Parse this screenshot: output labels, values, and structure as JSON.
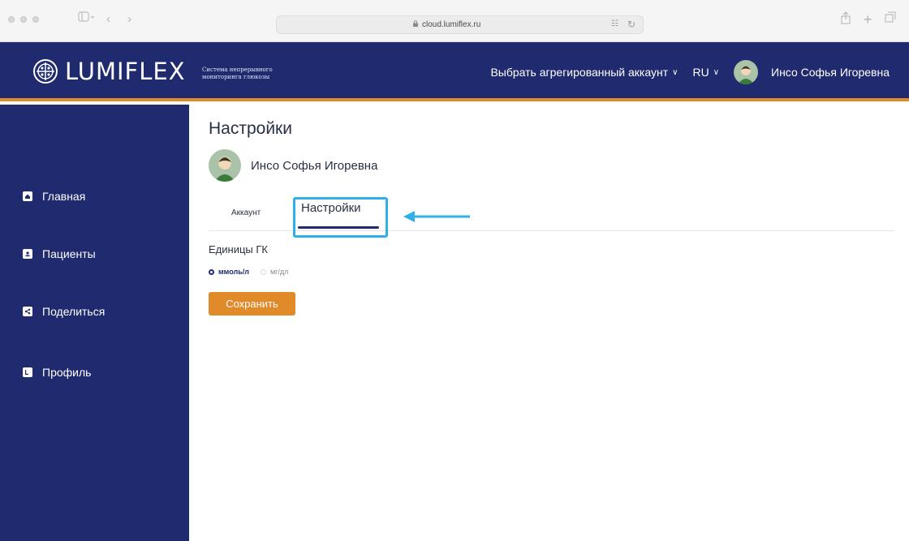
{
  "browser": {
    "url": "cloud.lumiflex.ru",
    "icons": [
      "sidebar-toggle-icon",
      "back-icon",
      "forward-icon",
      "lock-icon",
      "translate-icon",
      "reload-icon",
      "share-icon",
      "new-tab-icon",
      "tabs-icon"
    ]
  },
  "header": {
    "logo_text": "LUMIFLEX",
    "tagline": "Система непрерывного мониторинга глюкозы",
    "account_selector": "Выбрать агрегированный аккаунт",
    "language": "RU",
    "user_name": "Инсо Софья Игоревна"
  },
  "sidebar": {
    "items": [
      {
        "label": "Главная",
        "icon": "home-icon"
      },
      {
        "label": "Пациенты",
        "icon": "patients-icon"
      },
      {
        "label": "Поделиться",
        "icon": "share-icon"
      },
      {
        "label": "Профиль",
        "icon": "profile-icon"
      }
    ]
  },
  "main": {
    "title": "Настройки",
    "user_name": "Инсо Софья Игоревна",
    "tabs": [
      {
        "label": "Аккаунт",
        "active": false
      },
      {
        "label": "Настройки",
        "active": true
      }
    ],
    "units_title": "Единицы ГК",
    "units": [
      {
        "label": "ммоль/л",
        "selected": true
      },
      {
        "label": "мг/дл",
        "selected": false
      }
    ],
    "save_label": "Сохранить"
  },
  "colors": {
    "brand_navy": "#1f2b6e",
    "accent_orange": "#e08a2a",
    "highlight_blue": "#2fb0e8"
  }
}
